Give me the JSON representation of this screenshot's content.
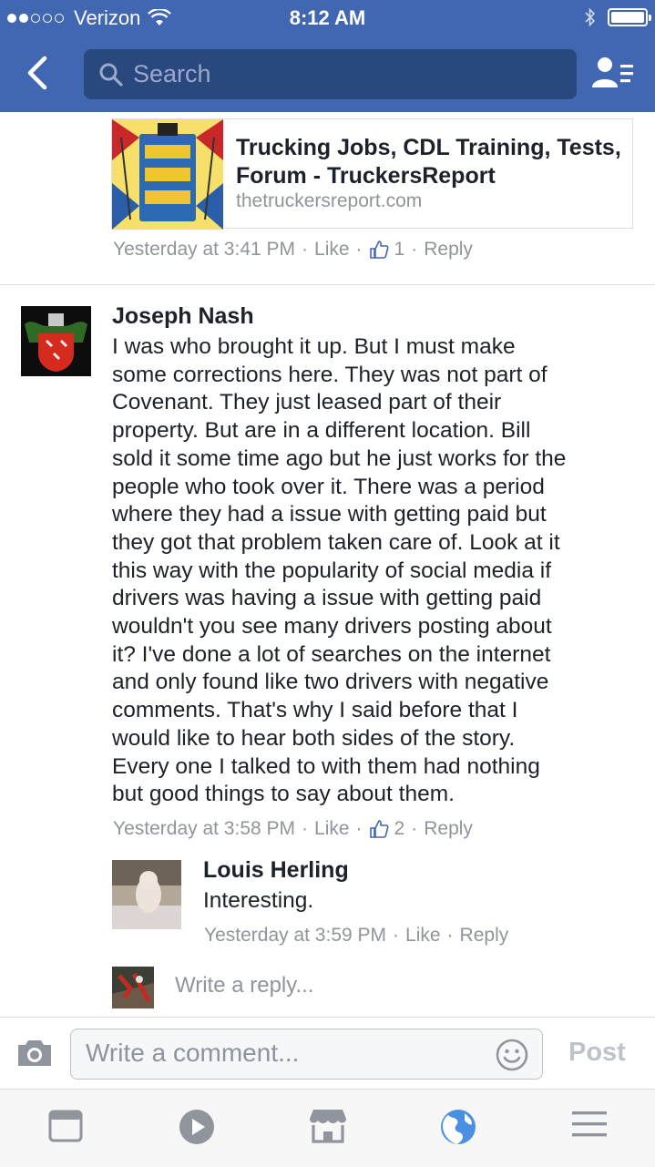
{
  "status_bar": {
    "carrier": "Verizon",
    "time": "8:12 AM"
  },
  "search": {
    "placeholder": "Search"
  },
  "link_preview": {
    "title": "Trucking Jobs, CDL Training, Tests, Forum - TruckersReport",
    "domain": "thetruckersreport.com"
  },
  "prev_comment_meta": {
    "timestamp": "Yesterday at 3:41 PM",
    "like": "Like",
    "like_count": "1",
    "reply": "Reply"
  },
  "comment": {
    "author": "Joseph Nash",
    "lines": [
      "I was who brought it up. But I must make",
      "some corrections here. They was not part of",
      "Covenant. They just leased part of their",
      "property. But are in a different location. Bill",
      "sold it some time ago but he just works for the",
      "people who took over it. There was a period",
      "where they had a issue with getting paid but",
      "they got that problem taken care of. Look at it",
      "this way with the popularity of social media if",
      "drivers was having a issue with getting paid",
      "wouldn't you see many drivers posting about",
      "it? I've done a lot of searches on the internet",
      "and only found like two drivers with negative",
      "comments. That's why I said before that I",
      "would like to hear both sides of the story.",
      "Every one I talked to with them had nothing",
      "but good things to say about them."
    ],
    "timestamp": "Yesterday at 3:58 PM",
    "like": "Like",
    "like_count": "2",
    "reply": "Reply"
  },
  "reply": {
    "author": "Louis Herling",
    "text": "Interesting.",
    "timestamp": "Yesterday at 3:59 PM",
    "like": "Like",
    "reply": "Reply"
  },
  "reply_input": {
    "placeholder": "Write a reply..."
  },
  "composer": {
    "placeholder": "Write a comment...",
    "post_label": "Post"
  },
  "tabs": [
    "news-feed-icon",
    "video-icon",
    "marketplace-icon",
    "globe-notifications-icon",
    "menu-icon"
  ],
  "colors": {
    "brand_blue": "#4267b2",
    "search_bg": "#29487d",
    "meta_gray": "#90949c",
    "active_tab": "#4a90e2"
  }
}
